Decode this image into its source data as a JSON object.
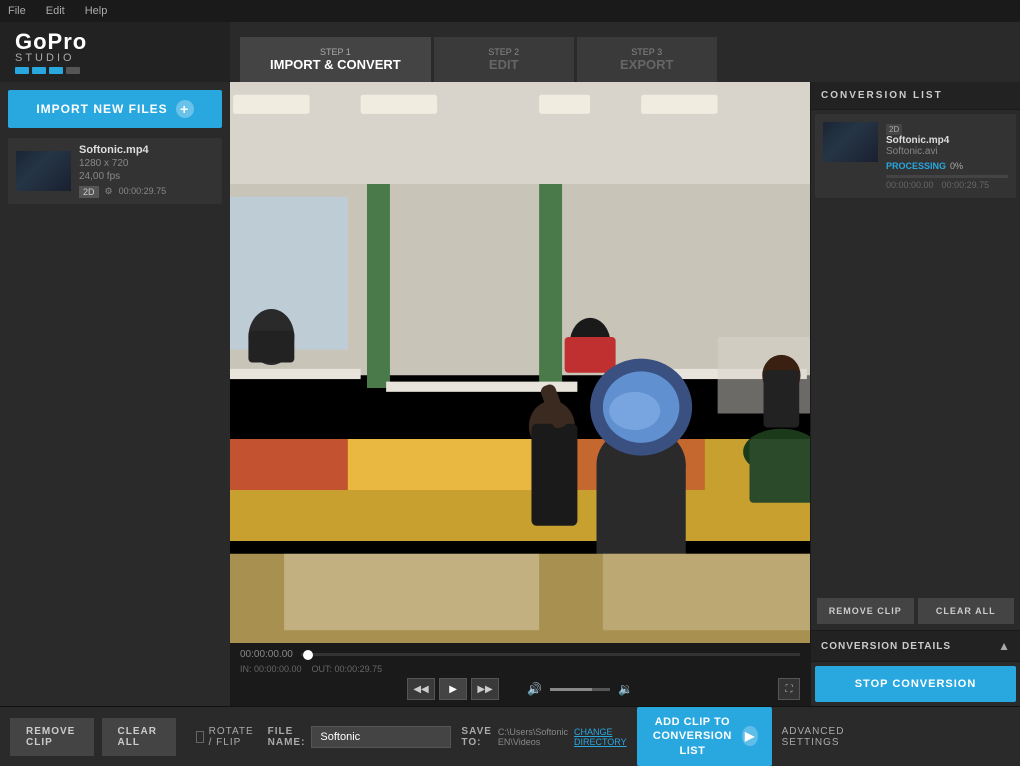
{
  "titlebar": {
    "file": "File",
    "edit": "Edit",
    "help": "Help"
  },
  "logo": {
    "brand": "GoPro",
    "studio": "STUDIO",
    "dots": [
      "#29a8e0",
      "#29a8e0",
      "#29a8e0",
      "#555"
    ]
  },
  "steps": [
    {
      "num": "STEP 1",
      "label": "IMPORT & CONVERT",
      "active": true
    },
    {
      "num": "STEP 2",
      "label": "EDIT",
      "active": false
    },
    {
      "num": "STEP 3",
      "label": "EXPORT",
      "active": false
    }
  ],
  "sidebar": {
    "import_btn": "IMPORT NEW FILES",
    "files": [
      {
        "name": "Softonic.mp4",
        "resolution": "1280 x 720",
        "fps": "24,00 fps",
        "badge": "2D",
        "duration": "00:00:29.75"
      }
    ]
  },
  "video": {
    "timecode": "00:00:00.00",
    "in_point": "IN: 00:00:00.00",
    "out_point": "OUT: 00:00:29.75"
  },
  "bottom": {
    "rotate_label": "ROTATE / FLIP",
    "filename_label": "FILE NAME:",
    "filename_value": "Softonic",
    "saveto_label": "SAVE TO:",
    "saveto_path": "C:\\Users\\Softonic EN\\Videos",
    "change_dir": "CHANGE DIRECTORY",
    "add_clip_label": "ADD CLIP TO\nCONVERSION LIST",
    "advanced_settings": "ADVANCED SETTINGS",
    "remove_clip": "REMOVE CLIP",
    "clear_all": "CLEAR ALL"
  },
  "conversion_list": {
    "title": "CONVERSION LIST",
    "items": [
      {
        "input_file": "Softonic.mp4",
        "output_file": "Softonic.avi",
        "progress_label": "PROCESSING",
        "progress_pct": "0%",
        "time_elapsed": "00:00:00.00",
        "time_total": "00:00:29.75",
        "badge": "2D"
      }
    ],
    "remove_clip": "REMOVE CLIP",
    "clear_all": "CLEAR ALL",
    "details_label": "CONVERSION DETAILS",
    "stop_btn": "STOP CONVERSION"
  }
}
